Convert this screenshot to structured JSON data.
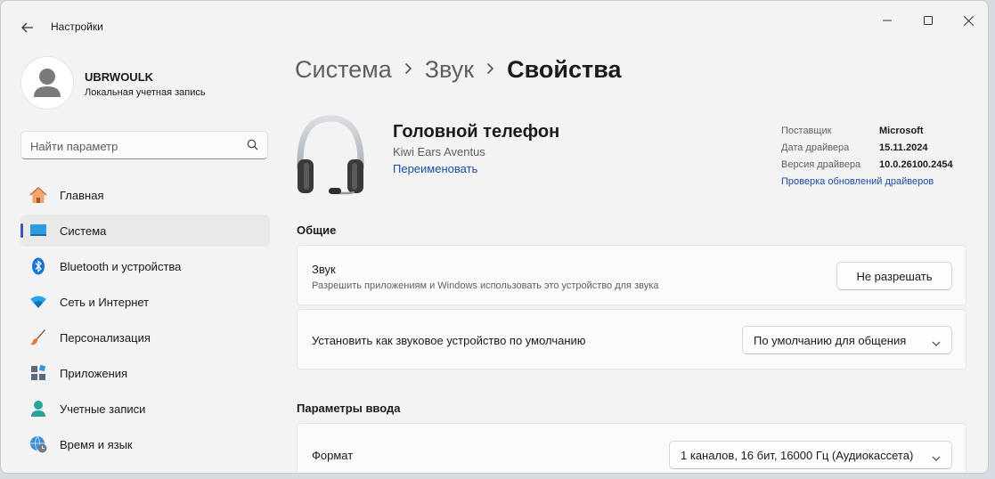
{
  "window": {
    "title": "Настройки"
  },
  "profile": {
    "name": "UBRWOULK",
    "subtitle": "Локальная учетная запись"
  },
  "search": {
    "placeholder": "Найти параметр"
  },
  "sidebar": {
    "items": [
      {
        "label": "Главная",
        "icon": "home-icon",
        "active": false
      },
      {
        "label": "Система",
        "icon": "system-icon",
        "active": true
      },
      {
        "label": "Bluetooth и устройства",
        "icon": "bluetooth-icon",
        "active": false
      },
      {
        "label": "Сеть и Интернет",
        "icon": "wifi-icon",
        "active": false
      },
      {
        "label": "Персонализация",
        "icon": "brush-icon",
        "active": false
      },
      {
        "label": "Приложения",
        "icon": "apps-icon",
        "active": false
      },
      {
        "label": "Учетные записи",
        "icon": "account-icon",
        "active": false
      },
      {
        "label": "Время и язык",
        "icon": "globe-clock-icon",
        "active": false
      }
    ]
  },
  "breadcrumb": {
    "items": [
      "Система",
      "Звук"
    ],
    "current": "Свойства"
  },
  "device": {
    "title": "Головной телефон",
    "model": "Kiwi Ears Aventus",
    "rename_link": "Переименовать",
    "info": [
      {
        "key": "Поставщик",
        "value": "Microsoft"
      },
      {
        "key": "Дата драйвера",
        "value": "15.11.2024"
      },
      {
        "key": "Версия драйвера",
        "value": "10.0.26100.2454"
      }
    ],
    "update_link": "Проверка обновлений драйверов"
  },
  "general": {
    "heading": "Общие",
    "sound": {
      "title": "Звук",
      "subtitle": "Разрешить приложениям и Windows использовать это устройство для звука",
      "button": "Не разрешать"
    },
    "default_device": {
      "title": "Установить как звуковое устройство по умолчанию",
      "selected": "По умолчанию для общения"
    }
  },
  "input": {
    "heading": "Параметры ввода",
    "format": {
      "title": "Формат",
      "selected": "1 каналов, 16 бит, 16000 Гц (Аудиокассета)"
    }
  },
  "colors": {
    "accent": "#3d54c4",
    "link": "#1c4ca8"
  }
}
